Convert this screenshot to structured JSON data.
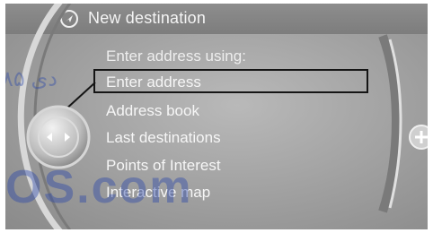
{
  "header": {
    "title": "New destination",
    "icon": "navigation-icon"
  },
  "menu": {
    "heading": "Enter address using:",
    "selected_index": 0,
    "items": [
      {
        "label": "Enter address"
      },
      {
        "label": "Address book"
      },
      {
        "label": "Last destinations"
      },
      {
        "label": "Points of Interest"
      },
      {
        "label": "Interactive map"
      }
    ]
  },
  "controller": {
    "icon": "idrive-controller-icon"
  },
  "side_button": {
    "icon": "plus-icon"
  },
  "watermark": {
    "text": "OS.com",
    "arabic_text": "۸۵ دی"
  },
  "colors": {
    "screen_background": "#a5a5a5",
    "header_background": "#868686",
    "text": "#f6f6f6",
    "highlight_border": "#151515"
  }
}
